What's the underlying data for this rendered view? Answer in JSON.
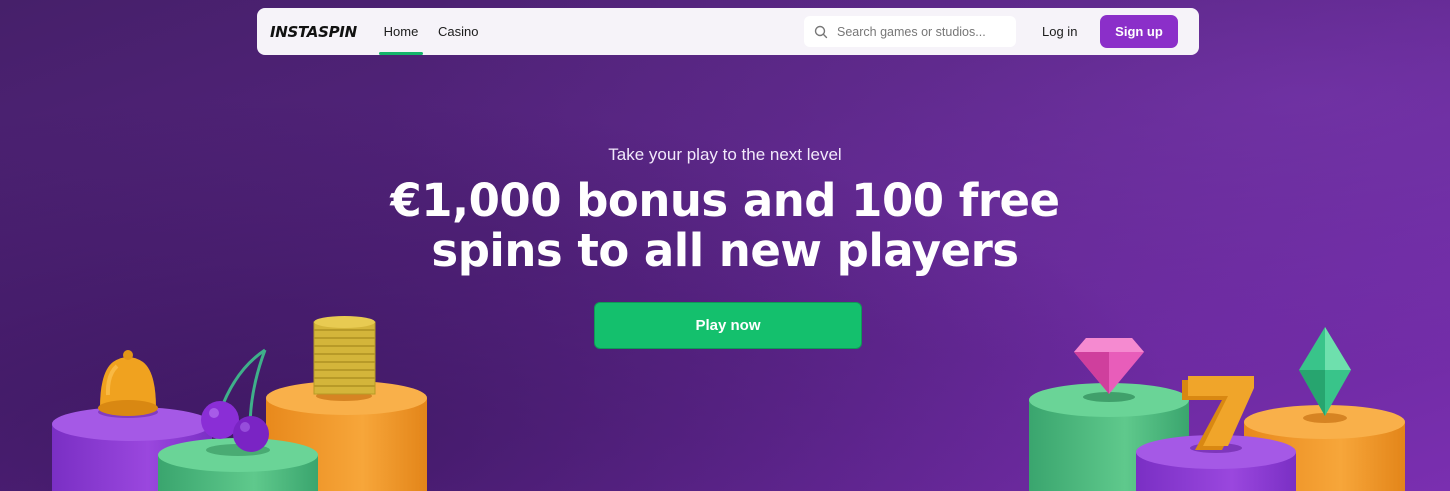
{
  "nav": {
    "logo": "INSTASPIN",
    "links": [
      {
        "label": "Home",
        "active": true
      },
      {
        "label": "Casino",
        "active": false
      }
    ],
    "search_placeholder": "Search games or studios...",
    "login_label": "Log in",
    "signup_label": "Sign up"
  },
  "hero": {
    "subtitle": "Take your play to the next level",
    "headline_line1": "€1,000 bonus and 100 free",
    "headline_line2": "spins to all new players",
    "cta_label": "Play now"
  },
  "colors": {
    "accent_purple": "#8b2fc9",
    "cta_green": "#14c06d",
    "active_underline": "#14b46a"
  }
}
